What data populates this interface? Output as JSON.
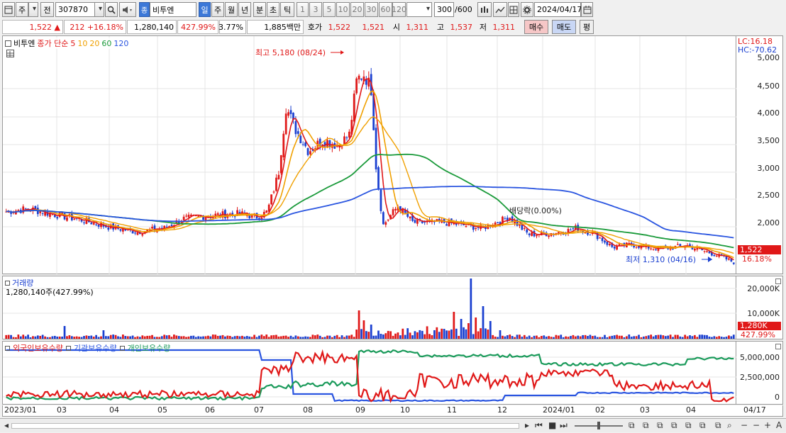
{
  "toolbar": {
    "period_label": "주",
    "prev_label": "전",
    "code_value": "307870",
    "name_prefix": "종",
    "name_value": "비투엔",
    "intervals": [
      "일",
      "주",
      "월",
      "년",
      "분",
      "초",
      "틱"
    ],
    "minute_options": [
      "1",
      "3",
      "5",
      "10",
      "20",
      "30",
      "60",
      "120"
    ],
    "count_value": "300",
    "count_max": "/600",
    "date_value": "2024/04/17"
  },
  "quote": {
    "price": "1,522",
    "change_arrow": "▲",
    "change": "212",
    "change_pct": "+16.18%",
    "volume": "1,280,140",
    "volume_pct": "427.99%",
    "turnover": "3.77%",
    "amount": "1,885",
    "amount_unit": "백만",
    "ask_label": "호가",
    "ask": "1,522",
    "bid": "1,521",
    "open_label": "시",
    "open": "1,311",
    "high_label": "고",
    "high": "1,537",
    "low_label": "저",
    "low": "1,311",
    "buy_label": "매수",
    "sell_label": "매도",
    "avg_label": "평"
  },
  "price_pane": {
    "stock_name": "비투엔",
    "ma_label": "종가 단순",
    "ma_periods": [
      "5",
      "10",
      "20",
      "60",
      "120"
    ],
    "ma_colors": [
      "#e01818",
      "#f0a000",
      "#f0a000",
      "#1a9a3a",
      "#2a55e0"
    ],
    "high_annotation": "최고 5,180 (08/24)",
    "low_annotation": "최저 1,310 (04/16)",
    "dividend_annotation": "배당락(0.00%)",
    "lc": "LC:16.18",
    "hc": "HC:-70.62",
    "ticks": [
      "5,000",
      "4,500",
      "4,000",
      "3,500",
      "3,000",
      "2,500",
      "2,000"
    ],
    "current_price_tag": "1,522",
    "current_pct": "16.18%"
  },
  "volume_pane": {
    "title": "거래량",
    "value": "1,280,140주(427.99%)",
    "ticks": [
      "20,000K",
      "10,000K"
    ],
    "current_tag": "1,280K",
    "current_pct": "427.99%"
  },
  "holdings_pane": {
    "series_labels": [
      "외국인보유수량",
      "기관보유수량",
      "개인보유수량"
    ],
    "series_colors": [
      "#e01818",
      "#2a55e0",
      "#1a9a5a"
    ],
    "ticks": [
      "5,000,000",
      "2,500,000",
      "0"
    ]
  },
  "xaxis": {
    "labels": [
      "2023/01",
      "03",
      "04",
      "05",
      "06",
      "07",
      "08",
      "09",
      "10",
      "11",
      "12",
      "2024/01",
      "02",
      "03",
      "04"
    ],
    "end_label": "04/17"
  },
  "colors": {
    "up": "#e01818",
    "down": "#1a3fd0",
    "selected": "#3c78d8"
  }
}
